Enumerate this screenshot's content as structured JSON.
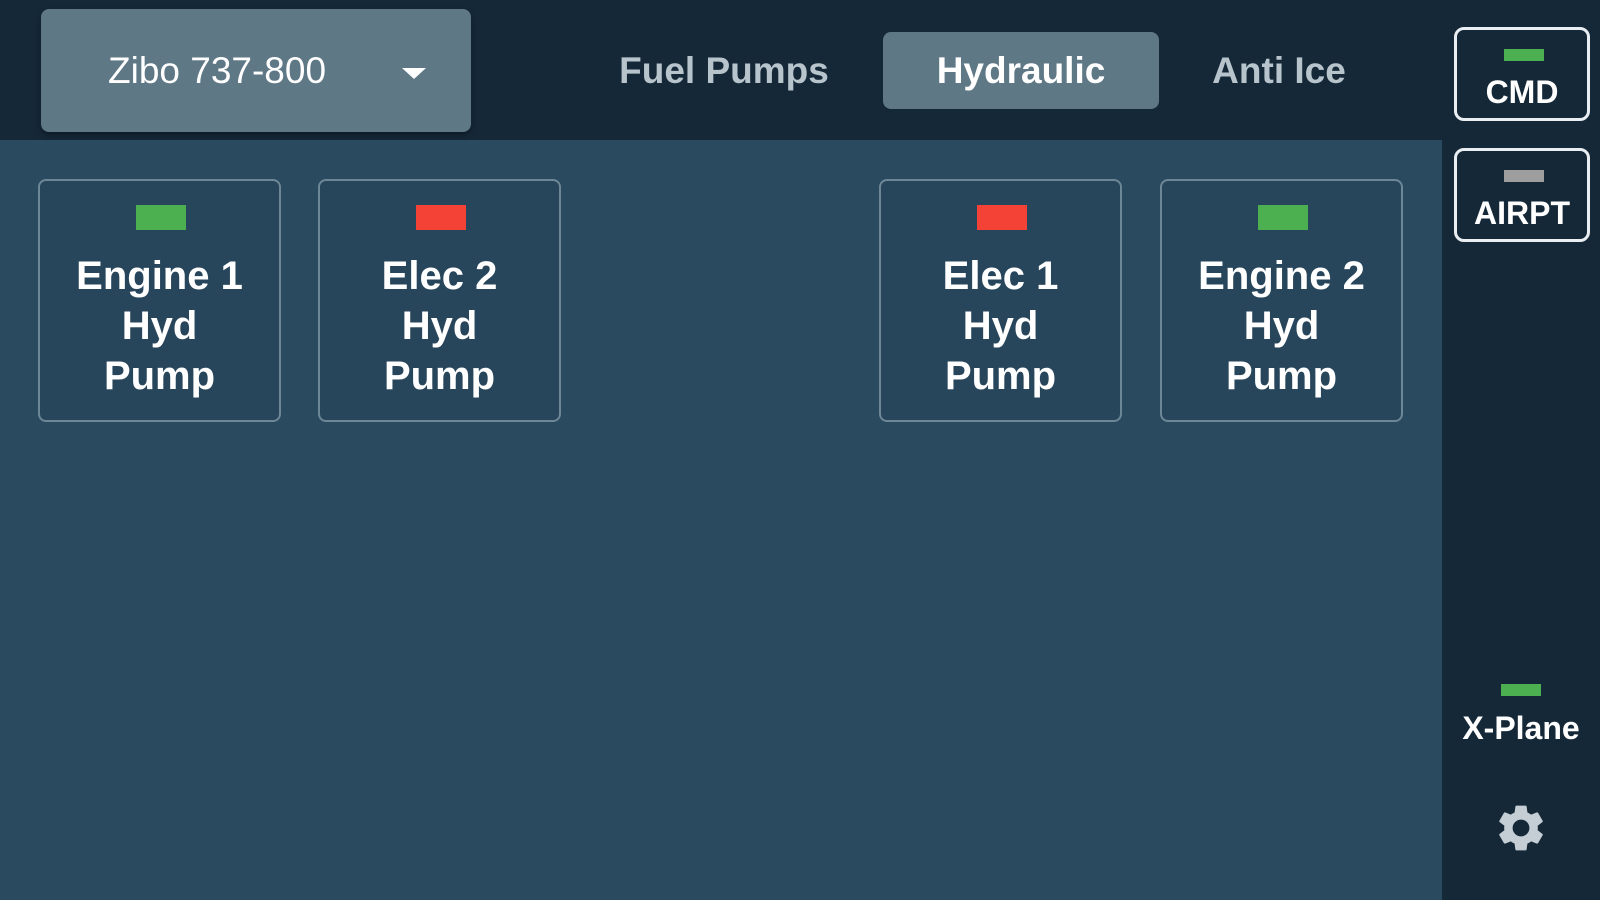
{
  "header": {
    "aircraft_select": {
      "value": "Zibo 737-800"
    },
    "tabs": [
      {
        "label": "Fuel Pumps",
        "active": false
      },
      {
        "label": "Hydraulic",
        "active": true
      },
      {
        "label": "Anti Ice",
        "active": false
      }
    ]
  },
  "sidebar": {
    "cmd": {
      "label": "CMD",
      "led_color": "#4caf50"
    },
    "airpt": {
      "label": "AIRPT",
      "led_color": "#9e9e9e"
    },
    "xplane": {
      "label": "X-Plane",
      "led_color": "#4caf50"
    },
    "settings_icon": "gear-icon"
  },
  "pumps": [
    {
      "lines": [
        "Engine 1",
        "Hyd",
        "Pump"
      ],
      "led_color": "#4caf50"
    },
    {
      "lines": [
        "Elec 2",
        "Hyd",
        "Pump"
      ],
      "led_color": "#f44336"
    },
    {
      "lines": [
        "Elec 1",
        "Hyd",
        "Pump"
      ],
      "led_color": "#f44336"
    },
    {
      "lines": [
        "Engine 2",
        "Hyd",
        "Pump"
      ],
      "led_color": "#4caf50"
    }
  ],
  "colors": {
    "background": "#2a4a60",
    "bar": "#152838",
    "active_tab": "#5f7886",
    "led_on": "#4caf50",
    "led_off": "#f44336",
    "led_idle": "#9e9e9e"
  }
}
